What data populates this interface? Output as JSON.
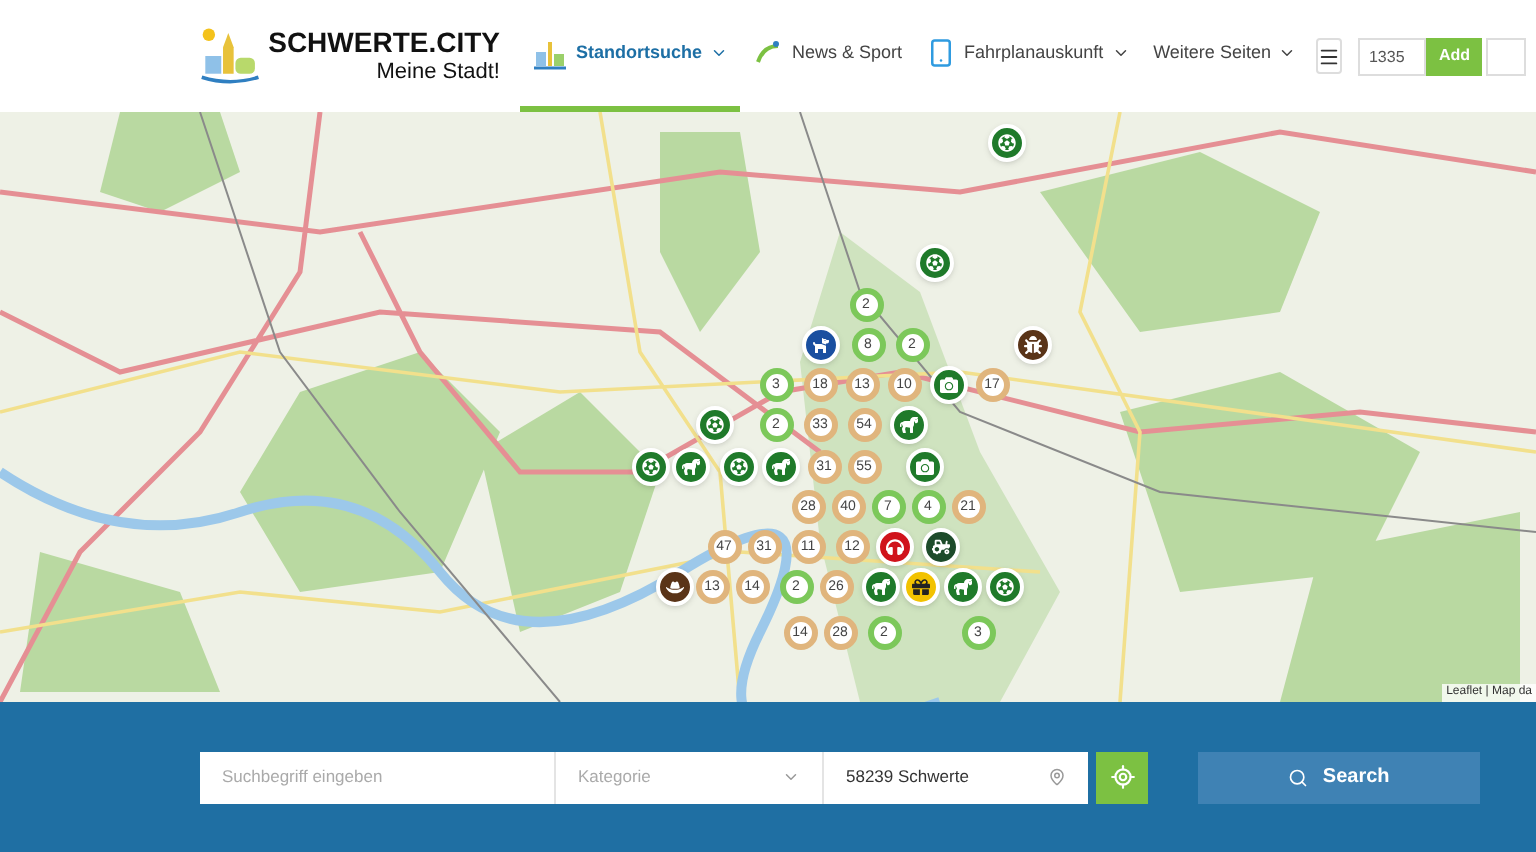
{
  "logo": {
    "title": "SCHWERTE.CITY",
    "tagline": "Meine Stadt!"
  },
  "nav": [
    {
      "label": "Standortsuche",
      "selected": true,
      "dropdown": true
    },
    {
      "label": "News & Sport",
      "selected": false,
      "dropdown": false
    },
    {
      "label": "Fahrplanauskunft",
      "selected": false,
      "dropdown": true
    },
    {
      "label": "Weitere Seiten",
      "selected": false,
      "dropdown": true
    }
  ],
  "add_field": {
    "value": "1335",
    "button": "Add"
  },
  "markers": [
    {
      "kind": "poi",
      "color": "#1f7a2a"
    },
    {
      "kind": "poi",
      "color": "#1f7a2a"
    },
    {
      "kind": "cluster",
      "label": "2",
      "color": "#7cc85a"
    },
    {
      "kind": "poi",
      "color": "#1a4fa0"
    },
    {
      "kind": "cluster",
      "label": "8",
      "color": "#7cc85a"
    },
    {
      "kind": "cluster",
      "label": "2",
      "color": "#7cc85a"
    },
    {
      "kind": "poi",
      "color": "#5a3418"
    },
    {
      "kind": "cluster",
      "label": "3",
      "color": "#7cc85a"
    },
    {
      "kind": "cluster",
      "label": "18",
      "color": "#e0b57d"
    },
    {
      "kind": "cluster",
      "label": "13",
      "color": "#e0b57d"
    },
    {
      "kind": "cluster",
      "label": "10",
      "color": "#e0b57d"
    },
    {
      "kind": "poi",
      "color": "#1f7a2a"
    },
    {
      "kind": "cluster",
      "label": "17",
      "color": "#e0b57d"
    },
    {
      "kind": "poi",
      "color": "#1f7a2a"
    },
    {
      "kind": "cluster",
      "label": "2",
      "color": "#7cc85a"
    },
    {
      "kind": "cluster",
      "label": "33",
      "color": "#e0b57d"
    },
    {
      "kind": "cluster",
      "label": "54",
      "color": "#e0b57d"
    },
    {
      "kind": "poi",
      "color": "#1f7a2a"
    },
    {
      "kind": "poi",
      "color": "#1f7a2a"
    },
    {
      "kind": "poi",
      "color": "#1f7a2a"
    },
    {
      "kind": "poi",
      "color": "#1f7a2a"
    },
    {
      "kind": "poi",
      "color": "#1f7a2a"
    },
    {
      "kind": "cluster",
      "label": "31",
      "color": "#e0b57d"
    },
    {
      "kind": "cluster",
      "label": "55",
      "color": "#e0b57d"
    },
    {
      "kind": "poi",
      "color": "#1f7a2a"
    },
    {
      "kind": "cluster",
      "label": "28",
      "color": "#e0b57d"
    },
    {
      "kind": "cluster",
      "label": "40",
      "color": "#e0b57d"
    },
    {
      "kind": "cluster",
      "label": "7",
      "color": "#7cc85a"
    },
    {
      "kind": "cluster",
      "label": "4",
      "color": "#7cc85a"
    },
    {
      "kind": "cluster",
      "label": "21",
      "color": "#e0b57d"
    },
    {
      "kind": "cluster",
      "label": "47",
      "color": "#e0b57d"
    },
    {
      "kind": "cluster",
      "label": "31",
      "color": "#e0b57d"
    },
    {
      "kind": "cluster",
      "label": "11",
      "color": "#e0b57d"
    },
    {
      "kind": "cluster",
      "label": "12",
      "color": "#e0b57d"
    },
    {
      "kind": "poi",
      "color": "#d0131b"
    },
    {
      "kind": "poi",
      "color": "#1d4b2a"
    },
    {
      "kind": "poi",
      "color": "#5a3418"
    },
    {
      "kind": "cluster",
      "label": "13",
      "color": "#e0b57d"
    },
    {
      "kind": "cluster",
      "label": "14",
      "color": "#e0b57d"
    },
    {
      "kind": "cluster",
      "label": "2",
      "color": "#7cc85a"
    },
    {
      "kind": "cluster",
      "label": "26",
      "color": "#e0b57d"
    },
    {
      "kind": "poi",
      "color": "#1f7a2a"
    },
    {
      "kind": "poi",
      "color": "#f2c200"
    },
    {
      "kind": "poi",
      "color": "#1f7a2a"
    },
    {
      "kind": "poi",
      "color": "#1f7a2a"
    },
    {
      "kind": "cluster",
      "label": "14",
      "color": "#e0b57d"
    },
    {
      "kind": "cluster",
      "label": "28",
      "color": "#e0b57d"
    },
    {
      "kind": "cluster",
      "label": "2",
      "color": "#7cc85a"
    },
    {
      "kind": "cluster",
      "label": "3",
      "color": "#7cc85a"
    }
  ],
  "attribution": "Leaflet | Map da",
  "search": {
    "placeholder": "Suchbegriff eingeben",
    "category_placeholder": "Kategorie",
    "location": "58239 Schwerte",
    "button": "Search"
  }
}
